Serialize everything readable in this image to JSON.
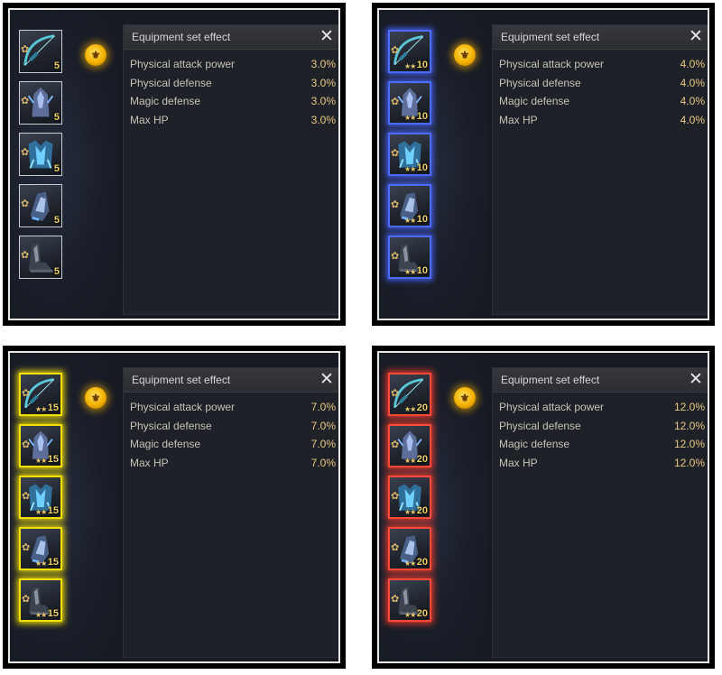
{
  "quadrants": [
    {
      "frame": "white",
      "set_icon": "gold-set-emblem-icon",
      "panel": {
        "title": "Equipment set effect",
        "close_label": "✕",
        "stats": [
          {
            "name": "Physical attack power",
            "value": "3.0%"
          },
          {
            "name": "Physical defense",
            "value": "3.0%"
          },
          {
            "name": "Magic defense",
            "value": "3.0%"
          },
          {
            "name": "Max HP",
            "value": "3.0%"
          }
        ]
      },
      "items": [
        {
          "icon": "bow-icon",
          "level": "5",
          "stars": ""
        },
        {
          "icon": "helmet-icon",
          "level": "5",
          "stars": ""
        },
        {
          "icon": "armor-icon",
          "level": "5",
          "stars": ""
        },
        {
          "icon": "gauntlet-icon",
          "level": "5",
          "stars": ""
        },
        {
          "icon": "boots-icon",
          "level": "5",
          "stars": ""
        }
      ]
    },
    {
      "frame": "blue",
      "set_icon": "gold-set-emblem-icon",
      "panel": {
        "title": "Equipment set effect",
        "close_label": "✕",
        "stats": [
          {
            "name": "Physical attack power",
            "value": "4.0%"
          },
          {
            "name": "Physical defense",
            "value": "4.0%"
          },
          {
            "name": "Magic defense",
            "value": "4.0%"
          },
          {
            "name": "Max HP",
            "value": "4.0%"
          }
        ]
      },
      "items": [
        {
          "icon": "bow-icon",
          "level": "10",
          "stars": "★★"
        },
        {
          "icon": "helmet-icon",
          "level": "10",
          "stars": "★★"
        },
        {
          "icon": "armor-icon",
          "level": "10",
          "stars": "★★"
        },
        {
          "icon": "gauntlet-icon",
          "level": "10",
          "stars": "★★"
        },
        {
          "icon": "boots-icon",
          "level": "10",
          "stars": "★★"
        }
      ]
    },
    {
      "frame": "yellow",
      "set_icon": "gold-set-emblem-icon",
      "panel": {
        "title": "Equipment set effect",
        "close_label": "✕",
        "stats": [
          {
            "name": "Physical attack power",
            "value": "7.0%"
          },
          {
            "name": "Physical defense",
            "value": "7.0%"
          },
          {
            "name": "Magic defense",
            "value": "7.0%"
          },
          {
            "name": "Max HP",
            "value": "7.0%"
          }
        ]
      },
      "items": [
        {
          "icon": "bow-icon",
          "level": "15",
          "stars": "★★"
        },
        {
          "icon": "helmet-icon",
          "level": "15",
          "stars": "★★"
        },
        {
          "icon": "armor-icon",
          "level": "15",
          "stars": "★★"
        },
        {
          "icon": "gauntlet-icon",
          "level": "15",
          "stars": "★★"
        },
        {
          "icon": "boots-icon",
          "level": "15",
          "stars": "★★"
        }
      ]
    },
    {
      "frame": "red",
      "set_icon": "gold-set-emblem-icon",
      "panel": {
        "title": "Equipment set effect",
        "close_label": "✕",
        "stats": [
          {
            "name": "Physical attack power",
            "value": "12.0%"
          },
          {
            "name": "Physical defense",
            "value": "12.0%"
          },
          {
            "name": "Magic defense",
            "value": "12.0%"
          },
          {
            "name": "Max HP",
            "value": "12.0%"
          }
        ]
      },
      "items": [
        {
          "icon": "bow-icon",
          "level": "20",
          "stars": "★★"
        },
        {
          "icon": "helmet-icon",
          "level": "20",
          "stars": "★★"
        },
        {
          "icon": "armor-icon",
          "level": "20",
          "stars": "★★"
        },
        {
          "icon": "gauntlet-icon",
          "level": "20",
          "stars": "★★"
        },
        {
          "icon": "boots-icon",
          "level": "20",
          "stars": "★★"
        }
      ]
    }
  ]
}
